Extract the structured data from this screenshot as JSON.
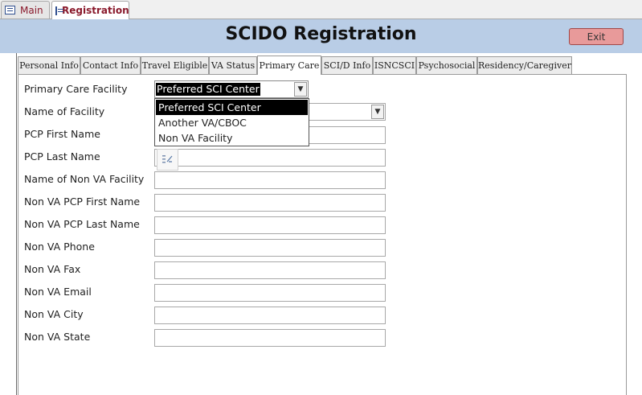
{
  "doc_tabs": {
    "main": "Main",
    "registration": "Registration"
  },
  "header": {
    "title": "SCIDO Registration",
    "exit_label": "Exit"
  },
  "tabs": [
    "Personal Info",
    "Contact Info",
    "Travel Eligible",
    "VA Status",
    "Primary Care",
    "SCI/D Info",
    "ISNCSCI",
    "Psychosocial",
    "Residency/Caregiver"
  ],
  "active_tab": "Primary Care",
  "fields": {
    "primary_care_facility": {
      "label": "Primary Care Facility",
      "value": "Preferred SCI Center"
    },
    "name_of_facility": {
      "label": "Name of Facility"
    },
    "pcp_first_name": {
      "label": "PCP First Name"
    },
    "pcp_last_name": {
      "label": "PCP Last Name"
    },
    "non_va_facility": {
      "label": "Name of Non VA Facility"
    },
    "non_va_pcp_first": {
      "label": "Non VA PCP First Name"
    },
    "non_va_pcp_last": {
      "label": "Non VA PCP Last Name"
    },
    "non_va_phone": {
      "label": "Non VA Phone"
    },
    "non_va_fax": {
      "label": "Non VA Fax"
    },
    "non_va_email": {
      "label": "Non VA Email"
    },
    "non_va_city": {
      "label": "Non VA City"
    },
    "non_va_state": {
      "label": "Non VA State"
    }
  },
  "dropdown_options": [
    "Preferred SCI Center",
    "Another VA/CBOC",
    "Non VA Facility"
  ],
  "icons": {
    "form": "form-icon",
    "dropdown": "chevron-down-icon",
    "smart_tag": "smart-tag-icon"
  },
  "colors": {
    "header": "#b9cde6",
    "exit": "#e89a9a",
    "doc_tab_text": "#8a1a2c"
  }
}
